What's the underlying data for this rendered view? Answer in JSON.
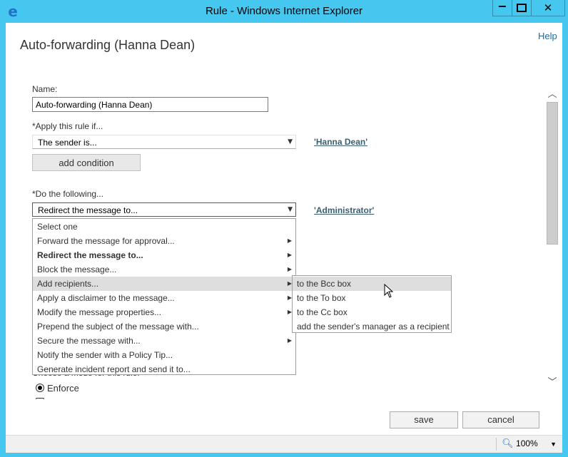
{
  "window": {
    "title": "Rule - Windows Internet Explorer",
    "minimize_label": "−",
    "close_label": "✕"
  },
  "page": {
    "help_label": "Help",
    "title": "Auto-forwarding (Hanna Dean)"
  },
  "form": {
    "name_label": "Name:",
    "name_value": "Auto-forwarding (Hanna Dean)",
    "apply_label": "*Apply this rule if...",
    "apply_value": "The sender is...",
    "sender_link": "'Hanna Dean'",
    "add_condition_label": "add condition",
    "do_label": "*Do the following...",
    "do_value": "Redirect the message to...",
    "admin_link": "'Administrator'",
    "mode_label": "Choose a mode for this rule:",
    "enforce_label": "Enforce",
    "save_label": "save",
    "cancel_label": "cancel"
  },
  "dropdown": {
    "items": [
      {
        "label": "Select one"
      },
      {
        "label": "Forward the message for approval..."
      },
      {
        "label": "Redirect the message to..."
      },
      {
        "label": "Block the message..."
      },
      {
        "label": "Add recipients..."
      },
      {
        "label": "Apply a disclaimer to the message..."
      },
      {
        "label": "Modify the message properties..."
      },
      {
        "label": "Prepend the subject of the message with..."
      },
      {
        "label": "Secure the message with..."
      },
      {
        "label": "Notify the sender with a Policy Tip..."
      },
      {
        "label": "Generate incident report and send it to..."
      }
    ],
    "selected_item": "Redirect the message to...",
    "highlighted_item": "Add recipients..."
  },
  "submenu": {
    "items": [
      {
        "label": "to the Bcc box"
      },
      {
        "label": "to the To box"
      },
      {
        "label": "to the Cc box"
      },
      {
        "label": "add the sender's manager as a recipient"
      }
    ],
    "highlighted_item": "to the Bcc box"
  },
  "status": {
    "zoom": "100%"
  },
  "colors": {
    "frame": "#45c7ef",
    "link": "#1f6aa5",
    "highlight": "#dedede"
  }
}
